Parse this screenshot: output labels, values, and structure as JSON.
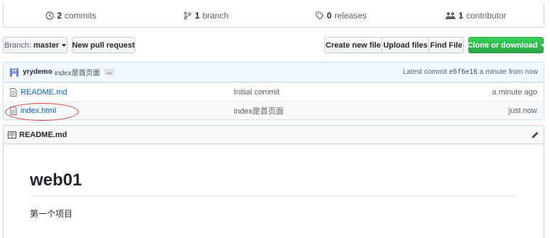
{
  "stats": {
    "commits_count": "2",
    "commits_label": "commits",
    "branch_count": "1",
    "branch_label": "branch",
    "releases_count": "0",
    "releases_label": "releases",
    "contributor_count": "1",
    "contributor_label": "contributor"
  },
  "toolbar": {
    "branch_label": "Branch:",
    "branch_value": "master",
    "new_pull_request": "New pull request",
    "create_new_file": "Create new file",
    "upload_files": "Upload files",
    "find_file": "Find File",
    "clone_or_download": "Clone or download"
  },
  "commit_tease": {
    "author": "yrydemo",
    "message": "index是首页面",
    "ellipsis": "…",
    "latest_label": "Latest commit",
    "sha": "e6f6e16",
    "time": "a minute from now"
  },
  "files": [
    {
      "name": "README.md",
      "message": "Initial commit",
      "age": "a minute ago"
    },
    {
      "name": "index.html",
      "message": "index是首页面",
      "age": "just now"
    }
  ],
  "readme": {
    "filename": "README.md",
    "heading": "web01",
    "paragraph": "第一个项目"
  },
  "colors": {
    "link": "#0366d6",
    "green": "#28a745",
    "highlight_oval": "#e0443c",
    "tease_bg": "#f1f8ff"
  }
}
